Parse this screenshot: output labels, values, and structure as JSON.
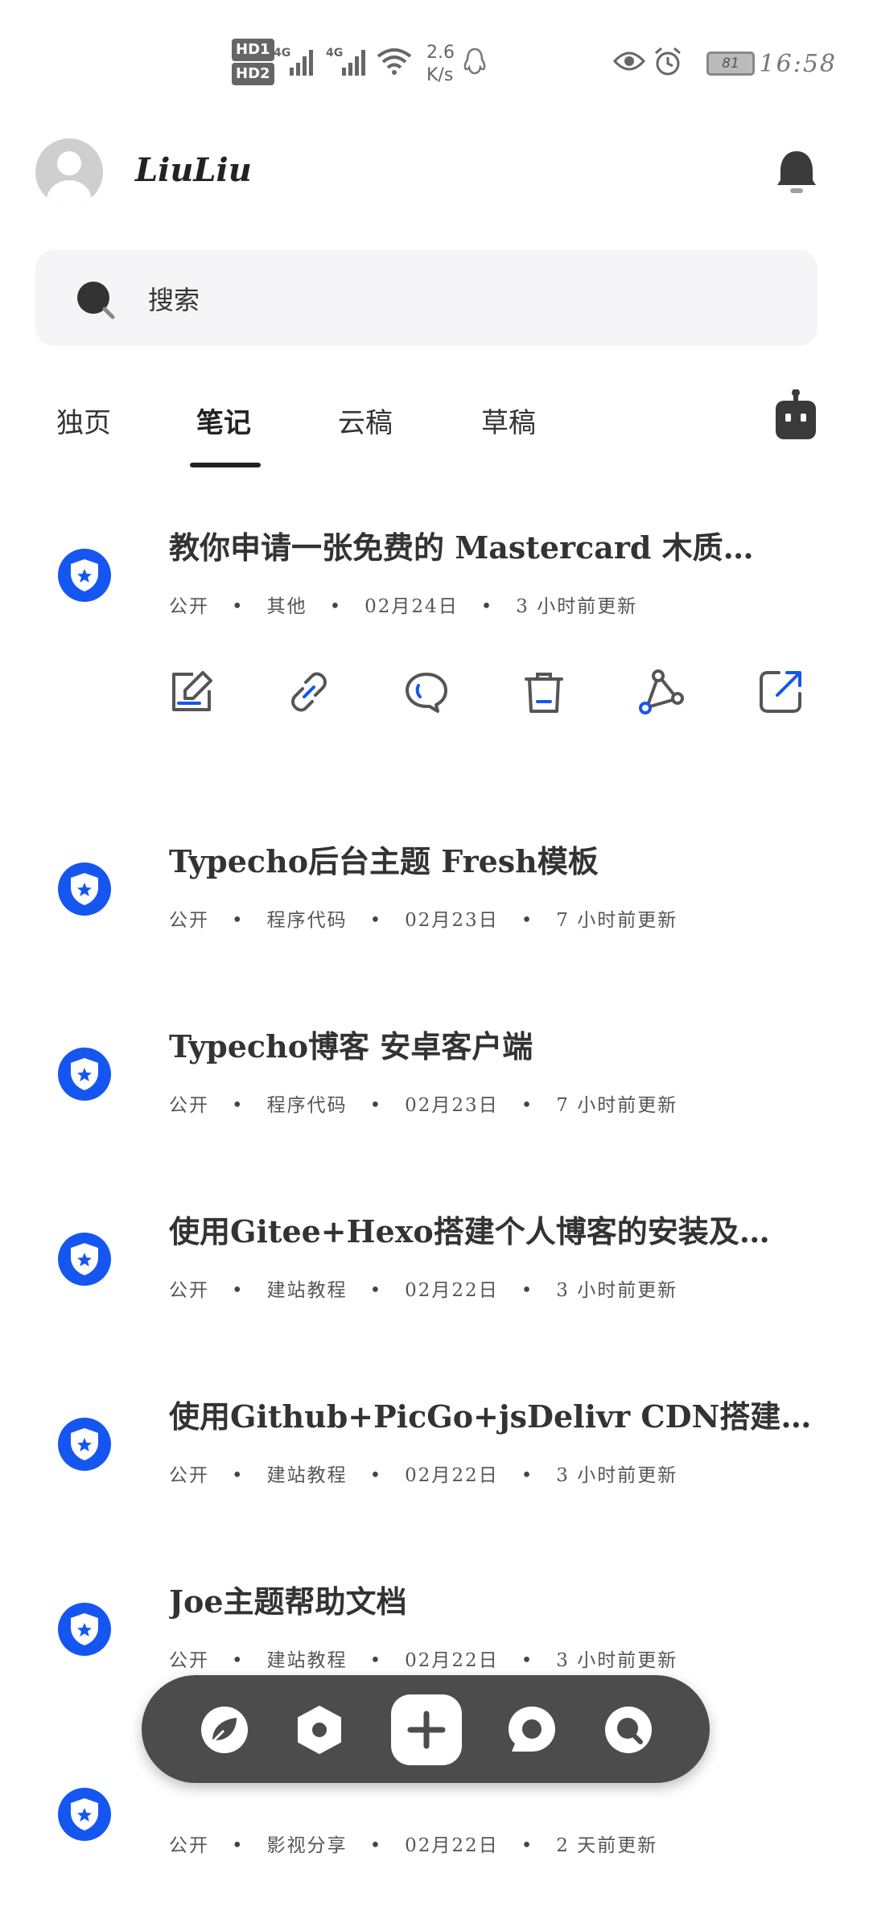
{
  "status_bar": {
    "hd1": "HD1",
    "hd2": "HD2",
    "net1": "4G",
    "net2": "4G",
    "speed_value": "2.6",
    "speed_unit": "K/s",
    "battery": "81",
    "time": "16:58"
  },
  "header": {
    "username": "LiuLiu"
  },
  "search": {
    "placeholder": "搜索"
  },
  "tabs": [
    {
      "label": "独页",
      "active": false
    },
    {
      "label": "笔记",
      "active": true
    },
    {
      "label": "云稿",
      "active": false
    },
    {
      "label": "草稿",
      "active": false
    }
  ],
  "posts": [
    {
      "title": "教你申请一张免费的 Mastercard 木质…",
      "visibility": "公开",
      "category": "其他",
      "date": "02月24日",
      "updated": "3 小时前更新"
    },
    {
      "title": "Typecho后台主题 Fresh模板",
      "visibility": "公开",
      "category": "程序代码",
      "date": "02月23日",
      "updated": "7 小时前更新"
    },
    {
      "title": "Typecho博客 安卓客户端",
      "visibility": "公开",
      "category": "程序代码",
      "date": "02月23日",
      "updated": "7 小时前更新"
    },
    {
      "title": "使用Gitee+Hexo搭建个人博客的安装及…",
      "visibility": "公开",
      "category": "建站教程",
      "date": "02月22日",
      "updated": "3 小时前更新"
    },
    {
      "title": "使用Github+PicGo+jsDelivr CDN搭建免…",
      "visibility": "公开",
      "category": "建站教程",
      "date": "02月22日",
      "updated": "3 小时前更新"
    },
    {
      "title": "Joe主题帮助文档",
      "visibility": "公开",
      "category": "建站教程",
      "date": "02月22日",
      "updated": "3 小时前更新"
    },
    {
      "title": "",
      "visibility": "公开",
      "category": "影视分享",
      "date": "02月22日",
      "updated": "2 天前更新"
    }
  ],
  "colors": {
    "accent": "#1656f0",
    "fab_bar": "#4c4c4c",
    "search_bg": "#f5f5f7"
  },
  "icons": {
    "action_edit": "edit-icon",
    "action_link": "link-icon",
    "action_comment": "comment-icon",
    "action_delete": "trash-icon",
    "action_share": "share-icon",
    "action_open": "open-external-icon",
    "fab_1": "leaf-icon",
    "fab_2": "hexagon-icon",
    "fab_3": "plus-icon",
    "fab_4": "chat-icon",
    "fab_5": "search-bubble-icon"
  }
}
